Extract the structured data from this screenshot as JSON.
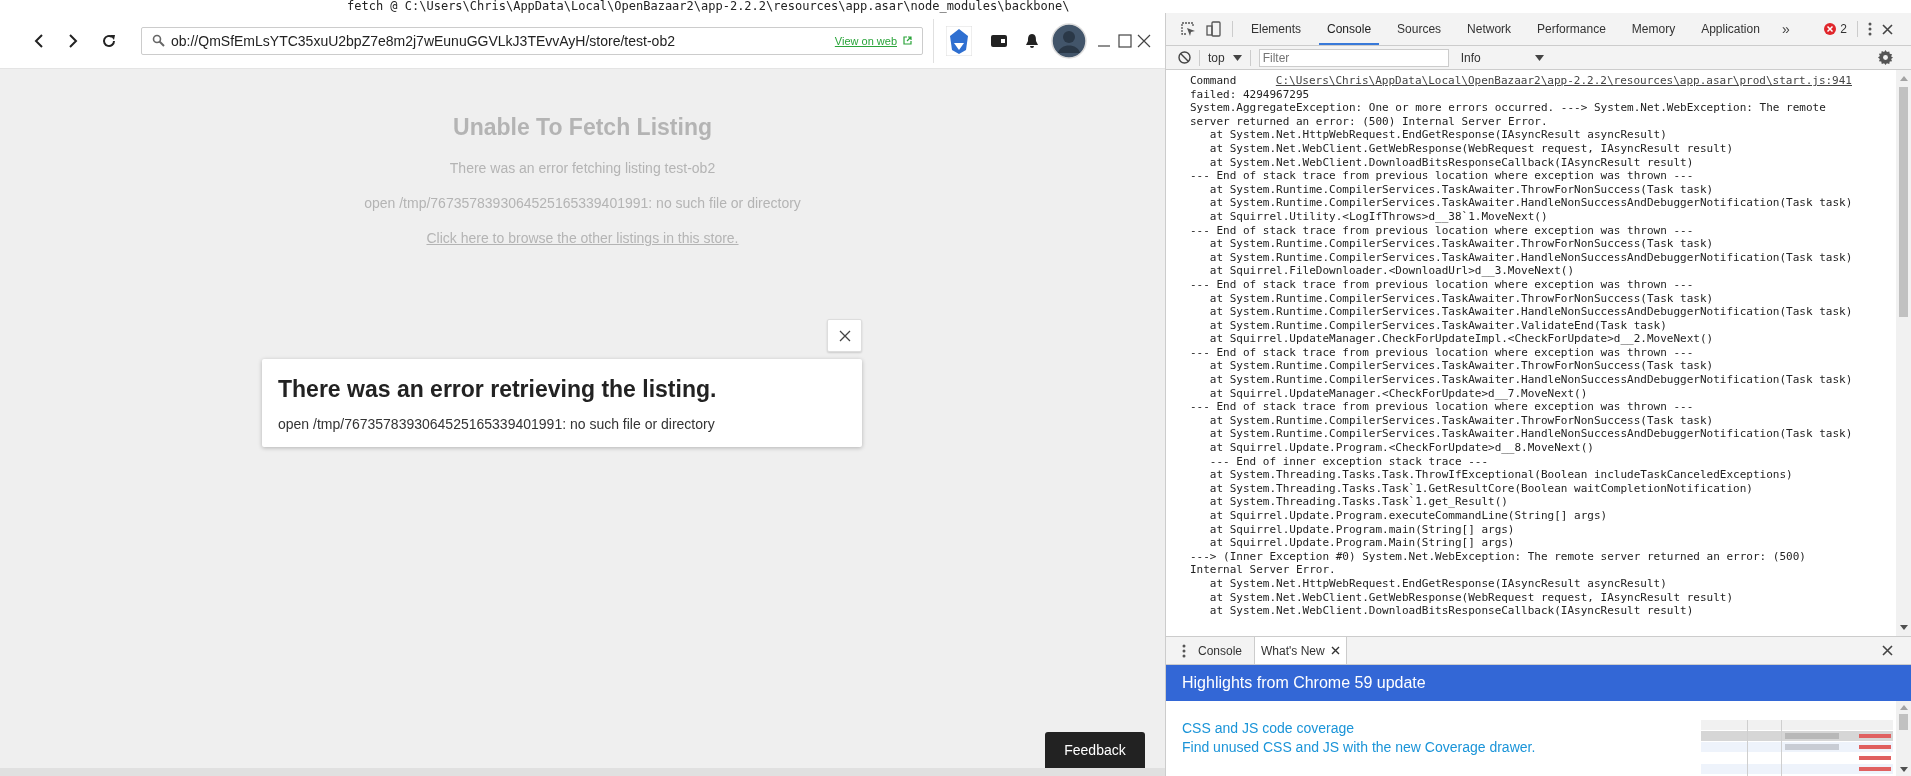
{
  "background_window": {
    "text": "fetch @ C:\\Users\\Chris\\AppData\\Local\\OpenBazaar2\\app-2.2.2\\resources\\app.asar\\node_modules\\backbone\\"
  },
  "browser": {
    "address": "ob://QmSfEmLsYTC35xuU2bpZ7e8m2j7wEunuGGVLkJ3TEvvAyH/store/test-ob2",
    "view_link": "View on web"
  },
  "page": {
    "title": "Unable To Fetch Listing",
    "message": "There was an error fetching listing test-ob2",
    "detail": "open /tmp/7673578393064525165339401991: no such file or directory",
    "link": "Click here to browse the other listings in this store."
  },
  "dialog": {
    "title": "There was an error retrieving the listing.",
    "message": "open /tmp/7673578393064525165339401991: no such file or directory"
  },
  "feedback": "Feedback",
  "devtools": {
    "tabs": [
      {
        "label": "Elements",
        "selected": false
      },
      {
        "label": "Console",
        "selected": true
      },
      {
        "label": "Sources",
        "selected": false
      },
      {
        "label": "Network",
        "selected": false
      },
      {
        "label": "Performance",
        "selected": false
      },
      {
        "label": "Memory",
        "selected": false
      },
      {
        "label": "Application",
        "selected": false
      }
    ],
    "more": "»",
    "error_count": "2",
    "context": "top",
    "filter_placeholder": "Filter",
    "log_level": "Info",
    "console": {
      "first_line": "Command",
      "source_link": "C:\\Users\\Chris\\AppData\\Local\\OpenBazaar2\\app-2.2.2\\resources\\app.asar\\prod\\start.js:941",
      "lines": [
        {
          "text": "failed: 4294967295",
          "indent": false
        },
        {
          "text": "System.AggregateException: One or more errors occurred. ---> System.Net.WebException: The remote",
          "indent": false
        },
        {
          "text": "server returned an error: (500) Internal Server Error.",
          "indent": false
        },
        {
          "text": "at System.Net.HttpWebRequest.EndGetResponse(IAsyncResult asyncResult)",
          "indent": true
        },
        {
          "text": "at System.Net.WebClient.GetWebResponse(WebRequest request, IAsyncResult result)",
          "indent": true
        },
        {
          "text": "at System.Net.WebClient.DownloadBitsResponseCallback(IAsyncResult result)",
          "indent": true
        },
        {
          "text": "--- End of stack trace from previous location where exception was thrown ---",
          "indent": false
        },
        {
          "text": "at System.Runtime.CompilerServices.TaskAwaiter.ThrowForNonSuccess(Task task)",
          "indent": true
        },
        {
          "text": "at System.Runtime.CompilerServices.TaskAwaiter.HandleNonSuccessAndDebuggerNotification(Task task)",
          "indent": true
        },
        {
          "text": "at Squirrel.Utility.<LogIfThrows>d__38`1.MoveNext()",
          "indent": true
        },
        {
          "text": "--- End of stack trace from previous location where exception was thrown ---",
          "indent": false
        },
        {
          "text": "at System.Runtime.CompilerServices.TaskAwaiter.ThrowForNonSuccess(Task task)",
          "indent": true
        },
        {
          "text": "at System.Runtime.CompilerServices.TaskAwaiter.HandleNonSuccessAndDebuggerNotification(Task task)",
          "indent": true
        },
        {
          "text": "at Squirrel.FileDownloader.<DownloadUrl>d__3.MoveNext()",
          "indent": true
        },
        {
          "text": "--- End of stack trace from previous location where exception was thrown ---",
          "indent": false
        },
        {
          "text": "at System.Runtime.CompilerServices.TaskAwaiter.ThrowForNonSuccess(Task task)",
          "indent": true
        },
        {
          "text": "at System.Runtime.CompilerServices.TaskAwaiter.HandleNonSuccessAndDebuggerNotification(Task task)",
          "indent": true
        },
        {
          "text": "at System.Runtime.CompilerServices.TaskAwaiter.ValidateEnd(Task task)",
          "indent": true
        },
        {
          "text": "at Squirrel.UpdateManager.CheckForUpdateImpl.<CheckForUpdate>d__2.MoveNext()",
          "indent": true
        },
        {
          "text": "--- End of stack trace from previous location where exception was thrown ---",
          "indent": false
        },
        {
          "text": "at System.Runtime.CompilerServices.TaskAwaiter.ThrowForNonSuccess(Task task)",
          "indent": true
        },
        {
          "text": "at System.Runtime.CompilerServices.TaskAwaiter.HandleNonSuccessAndDebuggerNotification(Task task)",
          "indent": true
        },
        {
          "text": "at Squirrel.UpdateManager.<CheckForUpdate>d__7.MoveNext()",
          "indent": true
        },
        {
          "text": "--- End of stack trace from previous location where exception was thrown ---",
          "indent": false
        },
        {
          "text": "at System.Runtime.CompilerServices.TaskAwaiter.ThrowForNonSuccess(Task task)",
          "indent": true
        },
        {
          "text": "at System.Runtime.CompilerServices.TaskAwaiter.HandleNonSuccessAndDebuggerNotification(Task task)",
          "indent": true
        },
        {
          "text": "at Squirrel.Update.Program.<CheckForUpdate>d__8.MoveNext()",
          "indent": true
        },
        {
          "text": "--- End of inner exception stack trace ---",
          "indent": true
        },
        {
          "text": "at System.Threading.Tasks.Task.ThrowIfExceptional(Boolean includeTaskCanceledExceptions)",
          "indent": true
        },
        {
          "text": "at System.Threading.Tasks.Task`1.GetResultCore(Boolean waitCompletionNotification)",
          "indent": true
        },
        {
          "text": "at System.Threading.Tasks.Task`1.get_Result()",
          "indent": true
        },
        {
          "text": "at Squirrel.Update.Program.executeCommandLine(String[] args)",
          "indent": true
        },
        {
          "text": "at Squirrel.Update.Program.main(String[] args)",
          "indent": true
        },
        {
          "text": "at Squirrel.Update.Program.Main(String[] args)",
          "indent": true
        },
        {
          "text": "---> (Inner Exception #0) System.Net.WebException: The remote server returned an error: (500)",
          "indent": false
        },
        {
          "text": "Internal Server Error.",
          "indent": false
        },
        {
          "text": "at System.Net.HttpWebRequest.EndGetResponse(IAsyncResult asyncResult)",
          "indent": true
        },
        {
          "text": "at System.Net.WebClient.GetWebResponse(WebRequest request, IAsyncResult result)",
          "indent": true
        },
        {
          "text": "at System.Net.WebClient.DownloadBitsResponseCallback(IAsyncResult result)",
          "indent": true
        }
      ]
    },
    "drawer": {
      "tabs": [
        {
          "label": "Console",
          "selected": false,
          "closable": false
        },
        {
          "label": "What's New",
          "selected": true,
          "closable": true
        }
      ],
      "banner": "Highlights from Chrome 59 update",
      "feature_title": "CSS and JS code coverage",
      "feature_text": "Find unused CSS and JS with the new Coverage drawer."
    }
  }
}
